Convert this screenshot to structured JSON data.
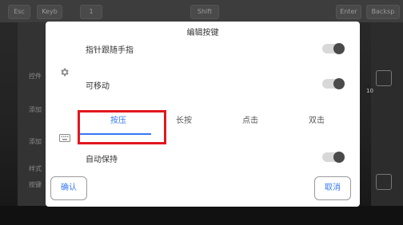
{
  "dialog": {
    "title": "编辑按键",
    "rows": {
      "follow_finger": {
        "label": "指针跟随手指",
        "enabled": false
      },
      "movable": {
        "label": "可移动",
        "enabled": false
      },
      "auto_hold": {
        "label": "自动保持",
        "enabled": false
      }
    },
    "tabs": [
      {
        "label": "按压",
        "active": true
      },
      {
        "label": "长按",
        "active": false
      },
      {
        "label": "点击",
        "active": false
      },
      {
        "label": "双击",
        "active": false
      }
    ],
    "confirm_label": "确认",
    "cancel_label": "取消"
  },
  "background": {
    "top_tabs": [
      "Esc",
      "Keyb",
      "1",
      "Shift",
      "Enter",
      "Backsp"
    ],
    "side_labels": [
      "控件",
      "添加",
      "添加",
      "样式",
      "按键"
    ],
    "right_number": "10"
  },
  "colors": {
    "accent": "#3478f6",
    "highlight": "#e2171e",
    "toggle_track": "#d8d8d8",
    "toggle_knob": "#4a4a4a"
  },
  "icons": {
    "settings": "gear-icon",
    "keyboard": "keyboard-icon"
  }
}
